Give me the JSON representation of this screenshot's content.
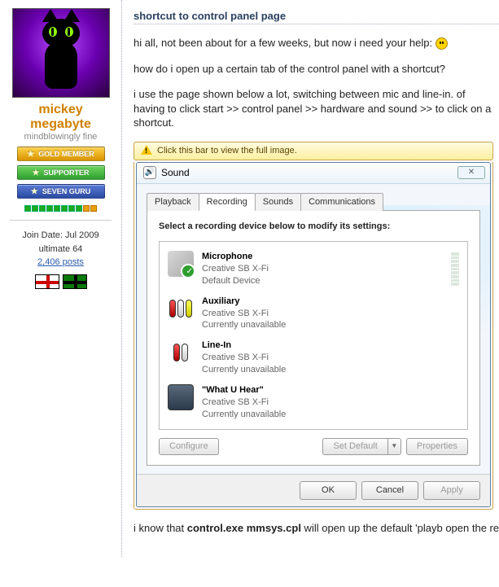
{
  "sidebar": {
    "username": "mickey megabyte",
    "user_title": "mindblowingly fine",
    "badges": {
      "gold": "GOLD MEMBER",
      "supporter": "SUPPORTER",
      "guru": "SEVEN GURU"
    },
    "join_date": "Join Date: Jul 2009",
    "spec": "ultimate 64",
    "posts": "2,406 posts"
  },
  "post": {
    "title": "shortcut to control panel page",
    "p1_a": "hi all, not been about for a few weeks, but now i need your help: ",
    "p2": "how do i open up a certain tab of the control panel with a shortcut?",
    "p3": "i use the page shown below a lot, switching between mic and line-in. of having to click start >> control panel >> hardware and sound >> to click on a shortcut.",
    "p4_a": "i know that ",
    "p4_b": "control.exe mmsys.cpl",
    "p4_c": " will open up the default 'playb open the recording tab?"
  },
  "imgbar": "Click this bar to view the full image.",
  "dialog": {
    "title": "Sound",
    "close": "✕",
    "tabs": [
      "Playback",
      "Recording",
      "Sounds",
      "Communications"
    ],
    "active_tab": 1,
    "instruction": "Select a recording device below to modify its settings:",
    "devices": [
      {
        "name": "Microphone",
        "line1": "Creative SB X-Fi",
        "line2": "Default Device",
        "icon": "mic"
      },
      {
        "name": "Auxiliary",
        "line1": "Creative SB X-Fi",
        "line2": "Currently unavailable",
        "icon": "aux"
      },
      {
        "name": "Line-In",
        "line1": "Creative SB X-Fi",
        "line2": "Currently unavailable",
        "icon": "linein"
      },
      {
        "name": "\"What U Hear\"",
        "line1": "Creative SB X-Fi",
        "line2": "Currently unavailable",
        "icon": "box"
      }
    ],
    "buttons": {
      "configure": "Configure",
      "set_default": "Set Default",
      "properties": "Properties",
      "ok": "OK",
      "cancel": "Cancel",
      "apply": "Apply"
    }
  }
}
